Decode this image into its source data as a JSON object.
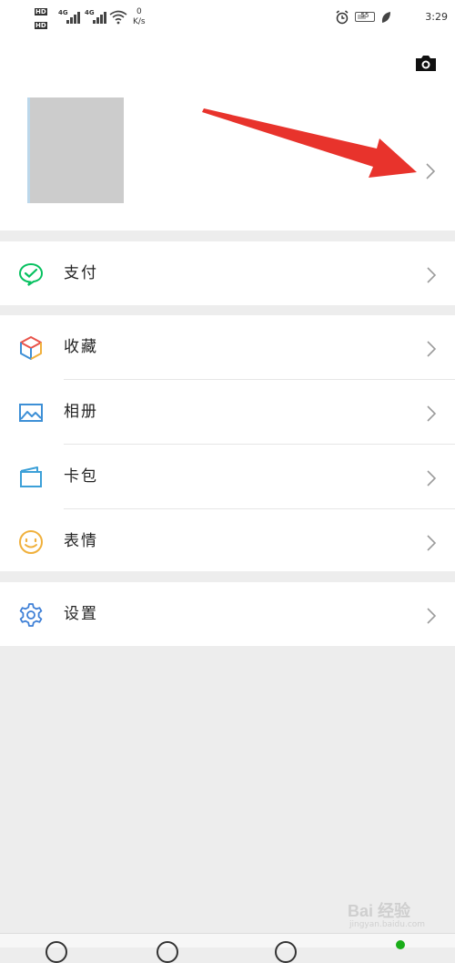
{
  "status_bar": {
    "hd_badges": [
      "HD",
      "HD"
    ],
    "network_tags": [
      "4G",
      "4G"
    ],
    "speed_value": "0",
    "speed_unit": "K/s",
    "battery": "55",
    "time": "3:29",
    "icons": [
      "alarm-icon",
      "battery-icon",
      "leaf-icon",
      "wifi-icon",
      "signal-icon"
    ]
  },
  "header": {
    "icons": [
      "camera-icon",
      "chevron-right-icon"
    ]
  },
  "menu": {
    "pay": {
      "label": "支付",
      "icon": "wechat-pay-icon",
      "color": "#07c160"
    },
    "favorites": {
      "label": "收藏",
      "icon": "cube-icon"
    },
    "album": {
      "label": "相册",
      "icon": "picture-icon",
      "color": "#3d8fd6"
    },
    "cards": {
      "label": "卡包",
      "icon": "card-wallet-icon",
      "color": "#3ca0d8"
    },
    "stickers": {
      "label": "表情",
      "icon": "smiley-icon",
      "color": "#f0b03c"
    },
    "settings": {
      "label": "设置",
      "icon": "gear-icon",
      "color": "#3d7fd6"
    }
  },
  "annotation": {
    "arrow_color": "#e8332c"
  },
  "watermark": {
    "brand": "Bai 经验",
    "site": "jingyan.baidu.com"
  },
  "tabbar": {
    "active_color": "#1aad19"
  }
}
